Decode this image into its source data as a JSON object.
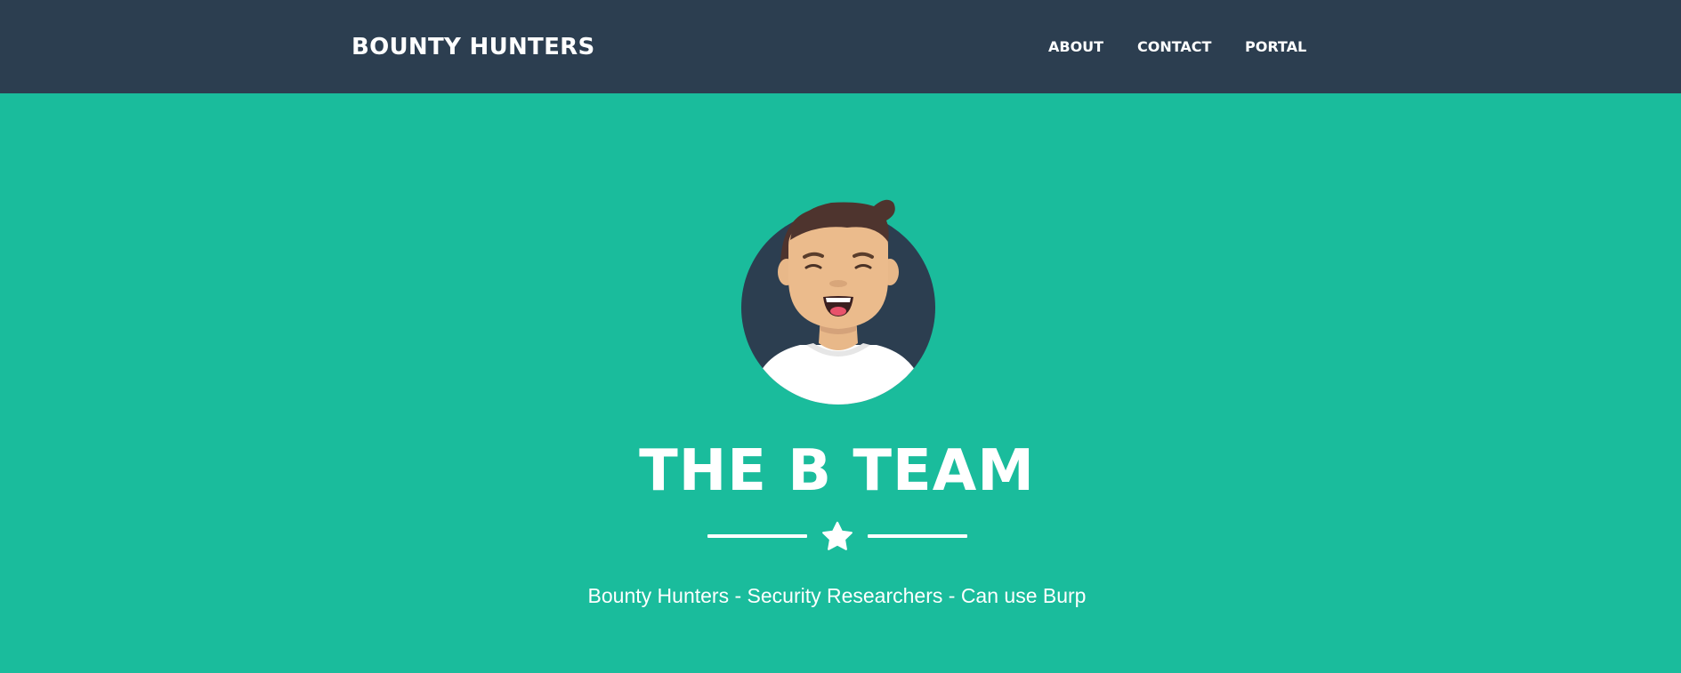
{
  "navbar": {
    "brand": "BOUNTY HUNTERS",
    "background": "#2c3e50",
    "items": [
      {
        "label": "ABOUT"
      },
      {
        "label": "CONTACT"
      },
      {
        "label": "PORTAL"
      }
    ]
  },
  "hero": {
    "background": "#1abc9c",
    "avatar_icon": "smiling-person-avatar-icon",
    "title": "THE B TEAM",
    "divider_icon": "star-icon",
    "subtitle": "Bounty Hunters - Security Researchers - Can use Burp"
  }
}
